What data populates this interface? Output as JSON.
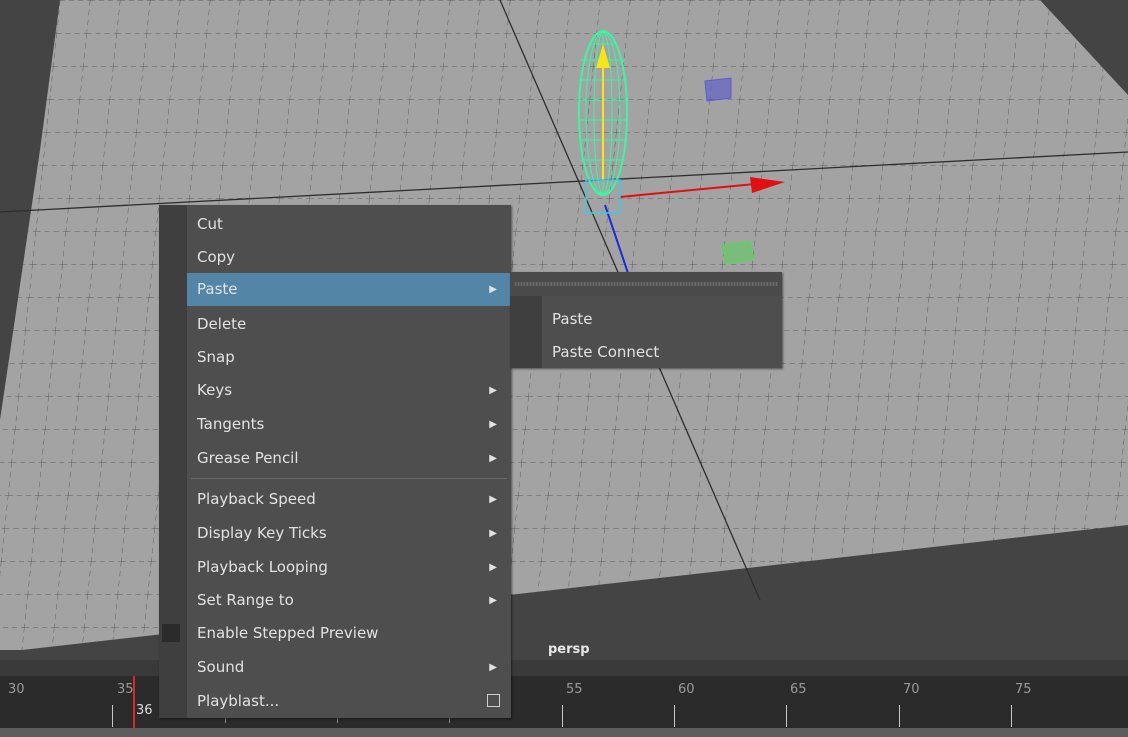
{
  "viewport": {
    "camera_label": "persp"
  },
  "context_menu": {
    "items": [
      {
        "label": "Cut"
      },
      {
        "label": "Copy"
      },
      {
        "label": "Paste"
      },
      {
        "label": "Delete"
      },
      {
        "label": "Snap"
      },
      {
        "label": "Keys"
      },
      {
        "label": "Tangents"
      },
      {
        "label": "Grease Pencil"
      },
      {
        "label": "Playback Speed"
      },
      {
        "label": "Display Key Ticks"
      },
      {
        "label": "Playback Looping"
      },
      {
        "label": "Set Range to"
      },
      {
        "label": "Enable Stepped Preview"
      },
      {
        "label": "Sound"
      },
      {
        "label": "Playblast..."
      }
    ],
    "submenu_arrow": "▶"
  },
  "paste_submenu": {
    "items": [
      {
        "label": "Paste"
      },
      {
        "label": "Paste Connect"
      }
    ]
  },
  "timeline": {
    "frame_numbers": [
      "30",
      "35",
      "55",
      "60",
      "65",
      "70",
      "75"
    ],
    "current_frame": "36"
  },
  "colors": {
    "highlight": "#5285a6",
    "menu_bg": "#4e4e4e",
    "ground": "#a3a3a3",
    "mesh": "#3df5a2",
    "x_axis": "#e01010",
    "y_axis": "#f5e51b",
    "z_axis": "#1b2bd8",
    "current_frame_marker": "#d42a2a"
  }
}
